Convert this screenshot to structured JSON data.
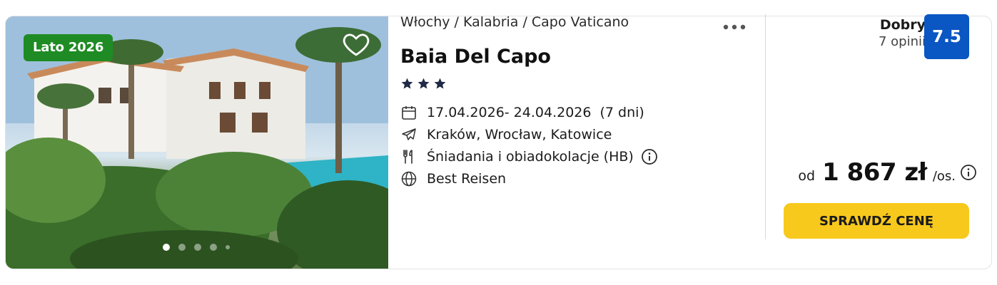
{
  "offer": {
    "season_badge": "Lato 2026",
    "breadcrumb": [
      "Włochy",
      "Kalabria",
      "Capo Vaticano"
    ],
    "breadcrumb_sep": "/",
    "hotel_name": "Baia Del Capo",
    "stars": 3,
    "dates": "17.04.2026- 24.04.2026",
    "duration": "(7 dni)",
    "departures": "Kraków, Wrocław, Katowice",
    "board": "Śniadania i obiadokolacje (HB)",
    "operator": "Best Reisen",
    "gallery": {
      "slides_shown": 5,
      "active_index": 0
    }
  },
  "rating": {
    "label": "Dobry",
    "count": "7 opinii",
    "score": "7.5"
  },
  "price": {
    "prefix": "od",
    "value": "1 867 zł",
    "suffix": "/os."
  },
  "cta": {
    "label": "SPRAWDŹ CENĘ"
  },
  "icons": {
    "favorite": "heart-outline-icon",
    "more": "more-horizontal-icon",
    "dates": "calendar-icon",
    "departures": "plane-icon",
    "board": "utensils-icon",
    "operator": "globe-icon",
    "info": "info-circle-icon"
  },
  "colors": {
    "badge_green": "#1f8b24",
    "score_blue": "#0a56c2",
    "cta_yellow": "#f7c91c"
  }
}
